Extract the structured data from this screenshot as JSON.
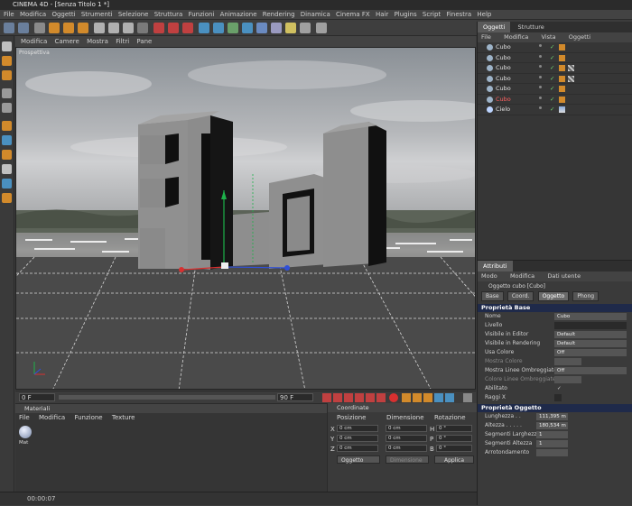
{
  "title": "CINEMA 4D - [Senza Titolo 1 *]",
  "menubar": [
    "File",
    "Modifica",
    "Oggetti",
    "Strumenti",
    "Selezione",
    "Struttura",
    "Funzioni",
    "Animazione",
    "Rendering",
    "Dinamica",
    "Cinema FX",
    "Hair",
    "Plugins",
    "Script",
    "Finestra",
    "Help"
  ],
  "viewport": {
    "menu": [
      "Modifica",
      "Camere",
      "Mostra",
      "Filtri",
      "Pane"
    ],
    "label": "Prospettiva"
  },
  "timeline": {
    "start": "0 F",
    "end": "90 F"
  },
  "materials": {
    "title": "Materiali",
    "menu": [
      "File",
      "Modifica",
      "Funzione",
      "Texture"
    ],
    "swatch_label": "Mat"
  },
  "coordinates": {
    "title": "Coordinate",
    "headers": [
      "Posizione",
      "Dimensione",
      "Rotazione"
    ],
    "rows": [
      {
        "axis": "X",
        "pos": "0 cm",
        "dim": "0 cm",
        "rot": "H",
        "rotval": "0 °"
      },
      {
        "axis": "Y",
        "pos": "0 cm",
        "dim": "0 cm",
        "rot": "P",
        "rotval": "0 °"
      },
      {
        "axis": "Z",
        "pos": "0 cm",
        "dim": "0 cm",
        "rot": "B",
        "rotval": "0 °"
      }
    ],
    "mode": "Oggetto",
    "size_mode": "Dimensione",
    "apply": "Applica"
  },
  "status": "00:00:07",
  "objects": {
    "tabs": [
      "Oggetti",
      "Strutture"
    ],
    "menu": [
      "File",
      "Modifica",
      "Vista",
      "Oggetti"
    ],
    "rows": [
      {
        "name": "Cubo",
        "color": "#9db3c8"
      },
      {
        "name": "Cubo",
        "color": "#9db3c8"
      },
      {
        "name": "Cubo",
        "color": "#9db3c8"
      },
      {
        "name": "Cubo",
        "color": "#9db3c8"
      },
      {
        "name": "Cubo",
        "color": "#9db3c8"
      },
      {
        "name": "Cubo",
        "color": "#e05050"
      },
      {
        "name": "Cielo",
        "color": "#9db3c8"
      }
    ]
  },
  "attributes": {
    "title": "Attributi",
    "menu": [
      "Modo",
      "Modifica",
      "Dati utente"
    ],
    "object_label": "Oggetto cubo [Cubo]",
    "tabs": [
      "Base",
      "Coord.",
      "Oggetto",
      "Phong"
    ],
    "sections": {
      "base": "Proprietà Base",
      "object": "Proprietà Oggetto"
    },
    "base_props": [
      {
        "label": "Nome",
        "value": "Cubo"
      },
      {
        "label": "Livello",
        "value": ""
      },
      {
        "label": "Visibile in Editor",
        "value": "Default"
      },
      {
        "label": "Visibile in Rendering",
        "value": "Default"
      },
      {
        "label": "Usa Colore",
        "value": "Off"
      },
      {
        "label": "Mostra Colore",
        "value": ""
      },
      {
        "label": "Mostra Linee Ombreggiate",
        "value": "Off"
      },
      {
        "label": "Colore Linee Ombreggiate",
        "value": ""
      },
      {
        "label": "Abilitato",
        "value": "✓"
      },
      {
        "label": "Raggi X",
        "value": ""
      }
    ],
    "object_props": [
      {
        "label": "Lunghezza . .",
        "value": "111,395 m"
      },
      {
        "label": "Altezza . . . . .",
        "value": "180,534 m"
      },
      {
        "label": "Segmenti Larghezza",
        "value": "1"
      },
      {
        "label": "Segmenti Altezza",
        "value": "1"
      },
      {
        "label": "Arrotondamento",
        "value": ""
      }
    ]
  }
}
